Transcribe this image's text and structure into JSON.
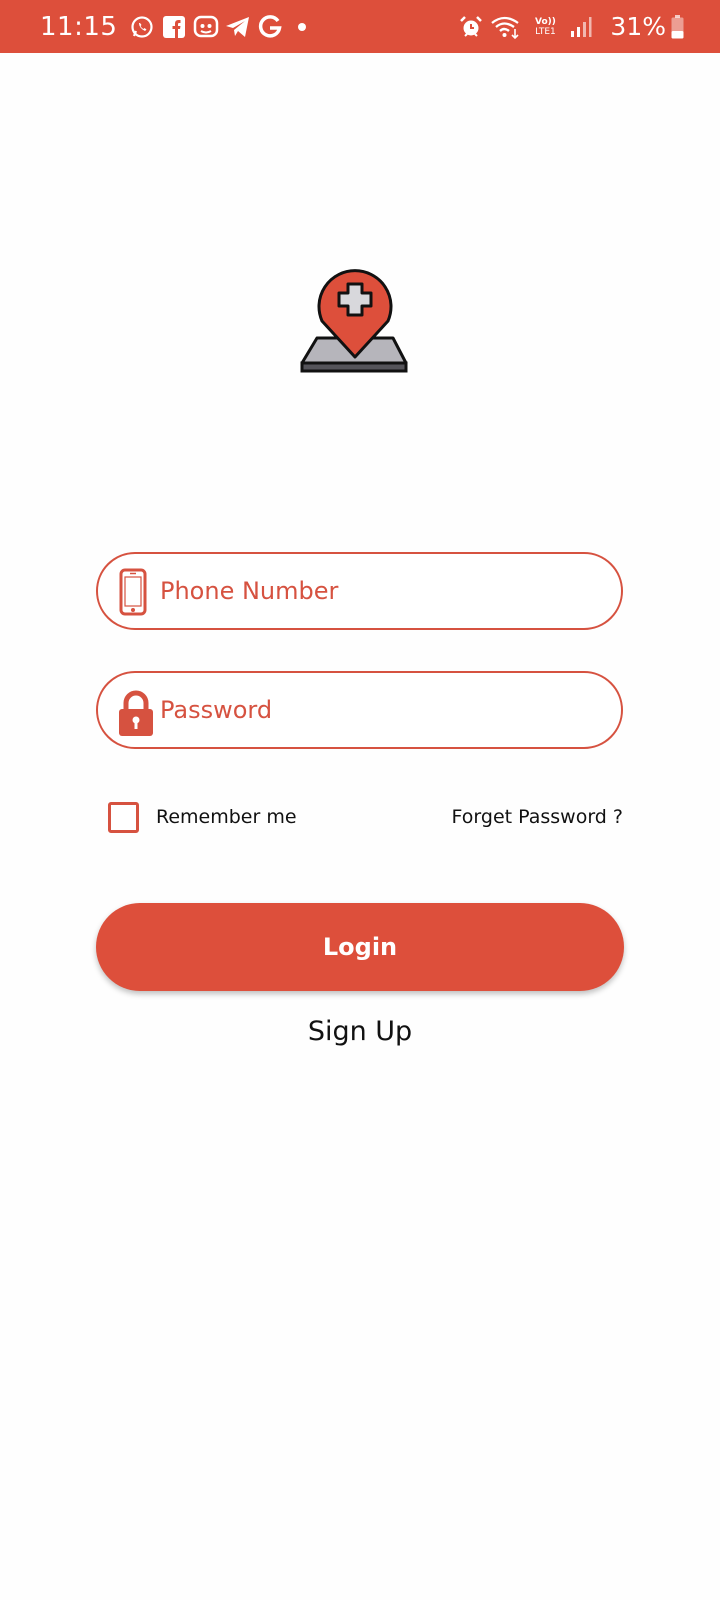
{
  "status_bar": {
    "time": "11:15",
    "left_icons": [
      "whatsapp-icon",
      "facebook-icon",
      "messenger-icon",
      "telegram-icon",
      "google-icon",
      "dot-icon"
    ],
    "right_icons": [
      "alarm-icon",
      "wifi-icon",
      "volte-icon",
      "signal-icon",
      "battery-icon"
    ],
    "volte_text_top": "Vo))",
    "volte_text_bottom": "LTE1",
    "battery_percent": "31%",
    "color": "#dd4f3b"
  },
  "logo": {
    "icon": "map-pin-medical-cross-icon"
  },
  "form": {
    "phone": {
      "placeholder": "Phone Number",
      "value": "",
      "icon": "phone-icon"
    },
    "password": {
      "placeholder": "Password",
      "value": "",
      "icon": "lock-icon"
    },
    "remember_label": "Remember me",
    "remember_checked": false,
    "forgot_label": "Forget Password ?",
    "login_label": "Login",
    "signup_label": "Sign Up"
  },
  "colors": {
    "accent": "#dd4f3b",
    "field_border": "#d65240",
    "text": "#111111",
    "background": "#fefefe"
  }
}
